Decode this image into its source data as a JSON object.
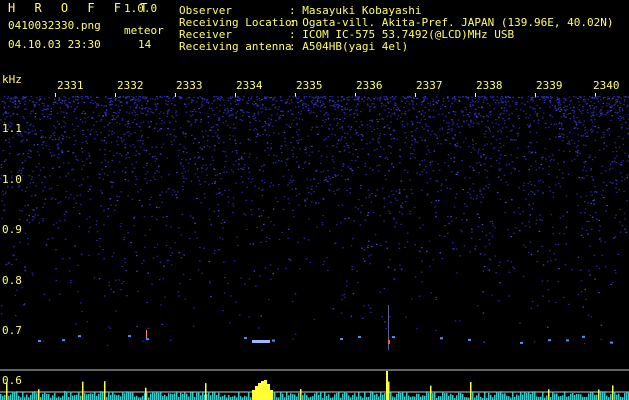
{
  "header": {
    "app_name": "H R O F F T",
    "version": "1.0.0",
    "file_name": "0410032330.png",
    "datetime": "04.10.03 23:30",
    "meteor_label": "meteor",
    "meteor_count": "14"
  },
  "info": {
    "rows": [
      {
        "label": "Observer",
        "value": ": Masayuki Kobayashi"
      },
      {
        "label": "Receiving Location",
        "value": ": Ogata-vill. Akita-Pref. JAPAN (139.96E, 40.02N)"
      },
      {
        "label": "Receiver",
        "value": ": ICOM IC-575 53.7492(@LCD)MHz USB"
      },
      {
        "label": "Receiving antenna",
        "value": ": A504HB(yagi 4el)"
      }
    ]
  },
  "axes": {
    "y_unit": "kHz",
    "time_ticks": [
      "2331",
      "2332",
      "2333",
      "2334",
      "2335",
      "2336",
      "2337",
      "2338",
      "2339",
      "2340"
    ],
    "freq_ticks": [
      "1.1",
      "1.0",
      "0.9",
      "0.8",
      "0.7",
      "0.6"
    ]
  },
  "colors": {
    "text": "#ffff66",
    "background": "#000000",
    "noise": "#2a2aa8",
    "echo": "#5a8cff",
    "spectrum_yellow": "#ffff33",
    "spectrum_cyan": "#33cccc",
    "gridline": "#c8c8c8"
  }
}
